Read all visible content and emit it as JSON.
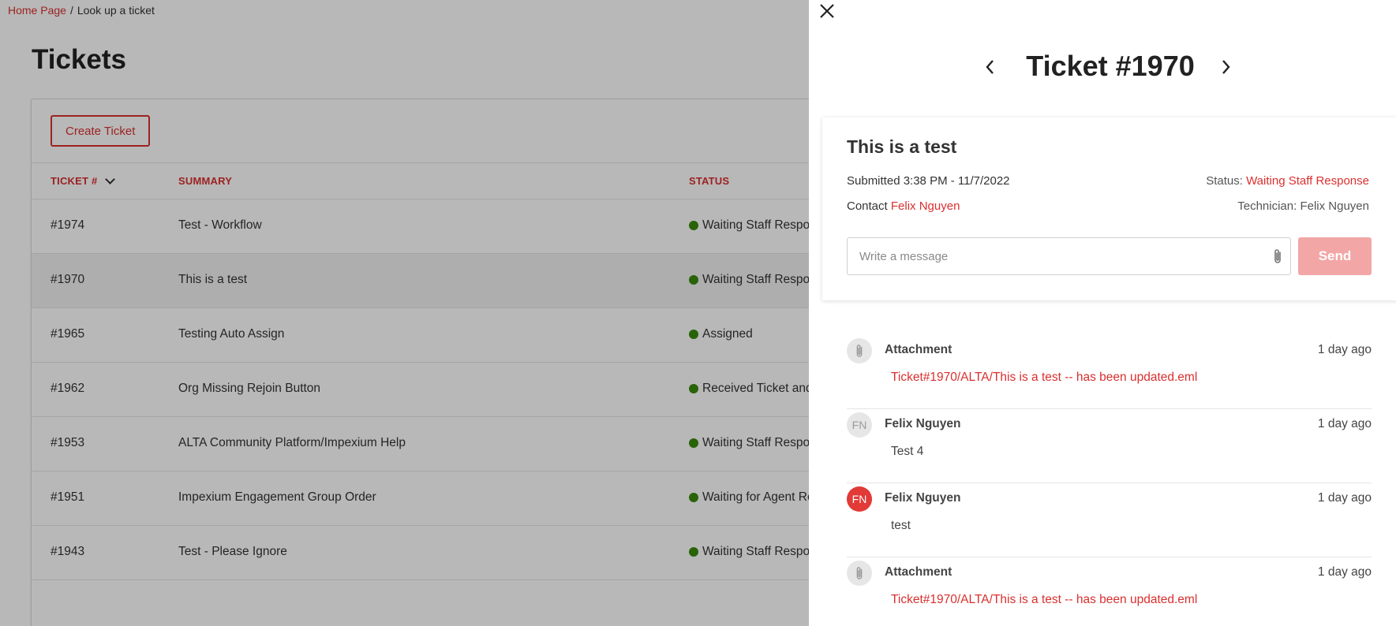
{
  "breadcrumb": {
    "home": "Home Page",
    "separator": "/",
    "current": "Look up a ticket"
  },
  "page": {
    "title": "Tickets",
    "create_button": "Create Ticket"
  },
  "table": {
    "headers": {
      "ticket": "TICKET #",
      "summary": "SUMMARY",
      "status": "STATUS"
    },
    "rows": [
      {
        "num": "#1974",
        "summary": "Test - Workflow",
        "status": "Waiting Staff Response"
      },
      {
        "num": "#1970",
        "summary": "This is a test",
        "status": "Waiting Staff Response"
      },
      {
        "num": "#1965",
        "summary": "Testing Auto Assign",
        "status": "Assigned"
      },
      {
        "num": "#1962",
        "summary": "Org Missing Rejoin Button",
        "status": "Received Ticket and"
      },
      {
        "num": "#1953",
        "summary": "ALTA Community Platform/Impexium Help",
        "status": "Waiting Staff Response"
      },
      {
        "num": "#1951",
        "summary": "Impexium Engagement Group Order",
        "status": "Waiting for Agent Response"
      },
      {
        "num": "#1943",
        "summary": "Test - Please Ignore",
        "status": "Waiting Staff Response"
      }
    ]
  },
  "panel": {
    "title": "Ticket #1970",
    "subject": "This is a test",
    "submitted": "Submitted 3:38 PM - 11/7/2022",
    "status_label": "Status:",
    "status_value": "Waiting Staff Response",
    "contact_label": "Contact",
    "contact_value": "Felix Nguyen",
    "technician": "Technician: Felix Nguyen",
    "message_placeholder": "Write a message",
    "send_label": "Send",
    "feed": [
      {
        "type": "attachment",
        "author": "Attachment",
        "time": "1 day ago",
        "text": "Ticket#1970/ALTA/This is a test -- has been updated.eml"
      },
      {
        "type": "message",
        "avatar": "FN",
        "author": "Felix Nguyen",
        "time": "1 day ago",
        "text": "Test 4"
      },
      {
        "type": "message",
        "avatar": "FN",
        "author": "Felix Nguyen",
        "time": "1 day ago",
        "text": "test"
      },
      {
        "type": "attachment",
        "author": "Attachment",
        "time": "1 day ago",
        "text": "Ticket#1970/ALTA/This is a test -- has been updated.eml"
      }
    ]
  },
  "colors": {
    "accent": "#d9302f",
    "status_dot": "#3a8a0c",
    "send_disabled": "#f2a7a6",
    "avatar_active": "#e23a37"
  },
  "icons": {
    "close": "close-icon",
    "prev": "chevron-left-icon",
    "next": "chevron-right-icon",
    "attach": "paperclip-icon",
    "sort": "chevron-down-icon"
  }
}
